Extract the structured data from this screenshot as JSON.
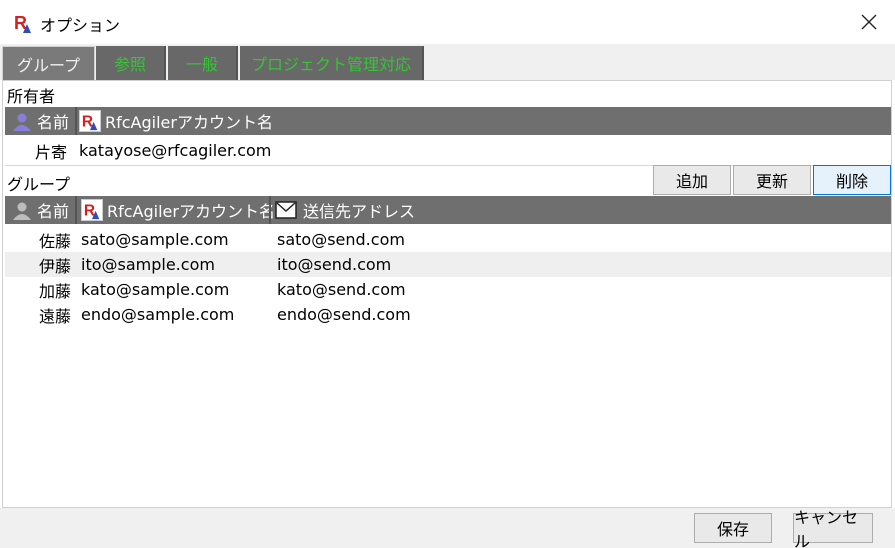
{
  "window": {
    "title": "オプション",
    "logo_icon": "rfcagiler-logo-icon",
    "close_icon": "close-icon"
  },
  "tabs": [
    {
      "label": "グループ",
      "active": true
    },
    {
      "label": "参照",
      "active": false
    },
    {
      "label": "一般",
      "active": false
    },
    {
      "label": "プロジェクト管理対応",
      "active": false
    }
  ],
  "owner": {
    "section_label": "所有者",
    "header": {
      "name": "名前",
      "account": "RfcAgilerアカウント名"
    },
    "row": {
      "name": "片寄",
      "account": "katayose@rfcagiler.com"
    }
  },
  "group": {
    "section_label": "グループ",
    "buttons": {
      "add": "追加",
      "update": "更新",
      "delete": "削除"
    },
    "header": {
      "name": "名前",
      "account": "RfcAgilerアカウント名",
      "send": "送信先アドレス"
    },
    "rows": [
      {
        "name": "佐藤",
        "account": "sato@sample.com",
        "send": "sato@send.com"
      },
      {
        "name": "伊藤",
        "account": "ito@sample.com",
        "send": "ito@send.com"
      },
      {
        "name": "加藤",
        "account": "kato@sample.com",
        "send": "kato@send.com"
      },
      {
        "name": "遠藤",
        "account": "endo@sample.com",
        "send": "endo@send.com"
      }
    ]
  },
  "footer": {
    "save": "保存",
    "cancel": "キャンセル"
  },
  "colors": {
    "tab_text": "#35c535",
    "header_bg": "#6f6f6f",
    "selected_border": "#0078d7",
    "person_icon_owner": "#8a7fd8",
    "person_icon_group": "#bdbdbd"
  }
}
